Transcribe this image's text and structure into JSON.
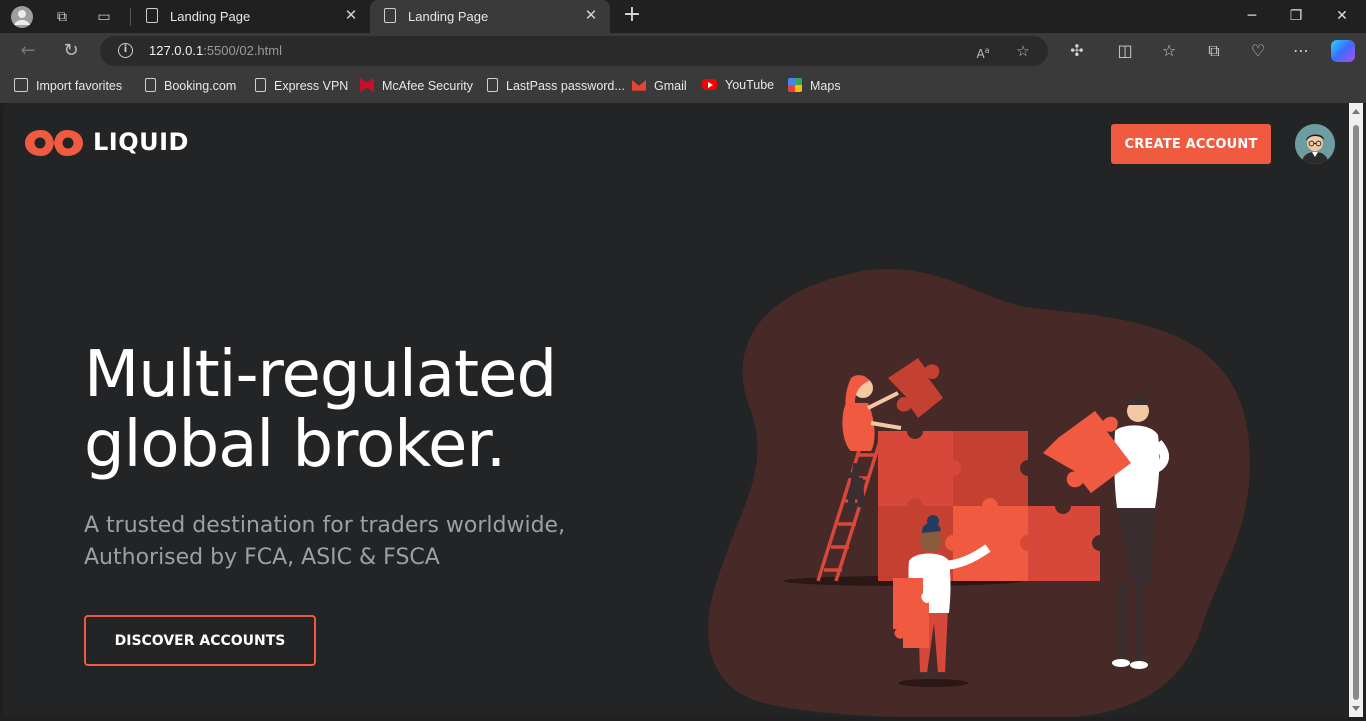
{
  "browser": {
    "tabs": [
      {
        "title": "Landing Page",
        "active": false
      },
      {
        "title": "Landing Page",
        "active": true
      }
    ],
    "url": {
      "host": "127.0.0.1",
      "path": ":5500/02.html"
    },
    "favorites": [
      {
        "label": "Import favorites",
        "icon": "import-icon"
      },
      {
        "label": "Booking.com",
        "icon": "page-icon"
      },
      {
        "label": "Express VPN",
        "icon": "page-icon"
      },
      {
        "label": "McAfee Security",
        "icon": "mcafee-icon"
      },
      {
        "label": "LastPass password...",
        "icon": "page-icon"
      },
      {
        "label": "Gmail",
        "icon": "gmail-icon"
      },
      {
        "label": "YouTube",
        "icon": "youtube-icon"
      },
      {
        "label": "Maps",
        "icon": "maps-icon"
      }
    ]
  },
  "page": {
    "brand": "LIQUID",
    "create_account": "CREATE ACCOUNT",
    "headline": [
      "Multi-regulated",
      "global broker."
    ],
    "subtitle": [
      "A trusted destination for traders worldwide,",
      "Authorised by FCA, ASIC & FSCA"
    ],
    "discover": "DISCOVER ACCOUNTS"
  },
  "colors": {
    "accent": "#f05a40",
    "page_bg": "#232426",
    "blob": "#472927"
  }
}
